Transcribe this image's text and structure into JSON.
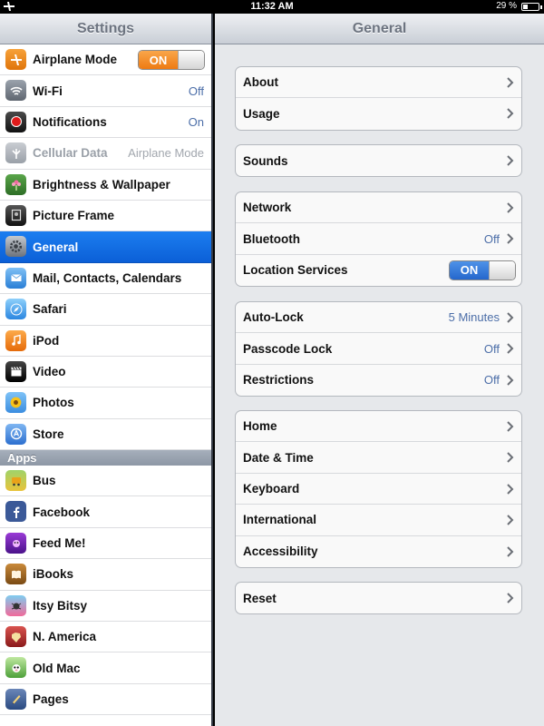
{
  "status_bar": {
    "time": "11:32 AM",
    "battery": "29 %"
  },
  "sidebar": {
    "title": "Settings",
    "items": [
      {
        "label": "Airplane Mode",
        "icon": "airplane-icon",
        "toggle": "ON"
      },
      {
        "label": "Wi-Fi",
        "icon": "wifi-icon",
        "value": "Off"
      },
      {
        "label": "Notifications",
        "icon": "notifications-icon",
        "value": "On"
      },
      {
        "label": "Cellular Data",
        "icon": "cellular-icon",
        "value": "Airplane Mode"
      },
      {
        "label": "Brightness & Wallpaper",
        "icon": "flower-icon"
      },
      {
        "label": "Picture Frame",
        "icon": "picture-frame-icon"
      },
      {
        "label": "General",
        "icon": "gear-icon"
      },
      {
        "label": "Mail, Contacts, Calendars",
        "icon": "mail-icon"
      },
      {
        "label": "Safari",
        "icon": "compass-icon"
      },
      {
        "label": "iPod",
        "icon": "music-note-icon"
      },
      {
        "label": "Video",
        "icon": "clapperboard-icon"
      },
      {
        "label": "Photos",
        "icon": "sunflower-icon"
      },
      {
        "label": "Store",
        "icon": "store-icon"
      }
    ],
    "apps_header": "Apps",
    "apps": [
      {
        "label": "Bus",
        "icon": "bus-app-icon"
      },
      {
        "label": "Facebook",
        "icon": "facebook-icon"
      },
      {
        "label": "Feed Me!",
        "icon": "feed-me-icon"
      },
      {
        "label": "iBooks",
        "icon": "ibooks-icon"
      },
      {
        "label": "Itsy Bitsy",
        "icon": "itsy-bitsy-icon"
      },
      {
        "label": "N. America",
        "icon": "n-america-icon"
      },
      {
        "label": "Old Mac",
        "icon": "old-mac-icon"
      },
      {
        "label": "Pages",
        "icon": "pages-icon"
      }
    ]
  },
  "main": {
    "title": "General",
    "groups": [
      [
        {
          "label": "About"
        },
        {
          "label": "Usage"
        }
      ],
      [
        {
          "label": "Sounds"
        }
      ],
      [
        {
          "label": "Network"
        },
        {
          "label": "Bluetooth",
          "value": "Off"
        },
        {
          "label": "Location Services",
          "toggle": "ON"
        }
      ],
      [
        {
          "label": "Auto-Lock",
          "value": "5 Minutes"
        },
        {
          "label": "Passcode Lock",
          "value": "Off"
        },
        {
          "label": "Restrictions",
          "value": "Off"
        }
      ],
      [
        {
          "label": "Home"
        },
        {
          "label": "Date & Time"
        },
        {
          "label": "Keyboard"
        },
        {
          "label": "International"
        },
        {
          "label": "Accessibility"
        }
      ],
      [
        {
          "label": "Reset"
        }
      ]
    ]
  },
  "colors": {
    "selected": "#0b6fe0",
    "airplane_toggle": "#f08a20",
    "location_toggle": "#2f72d6",
    "value_text": "#4c6ea8"
  }
}
